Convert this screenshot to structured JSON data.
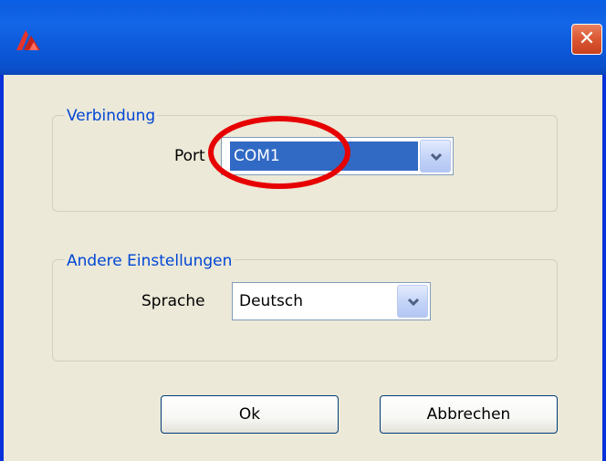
{
  "window": {
    "title": "",
    "close_glyph": "✕",
    "icon": "app-logo-icon"
  },
  "connection_group": {
    "legend": "Verbindung",
    "port_label": "Port",
    "port_value": "COM1"
  },
  "other_group": {
    "legend": "Andere Einstellungen",
    "language_label": "Sprache",
    "language_value": "Deutsch"
  },
  "buttons": {
    "ok_label": "Ok",
    "cancel_label": "Abbrechen"
  },
  "colors": {
    "titlebar": "#0a58d8",
    "dialog_background": "#ece9d8",
    "legend_text": "#0046d5",
    "selection": "#316ac5",
    "annotation_ellipse": "#e60000"
  }
}
